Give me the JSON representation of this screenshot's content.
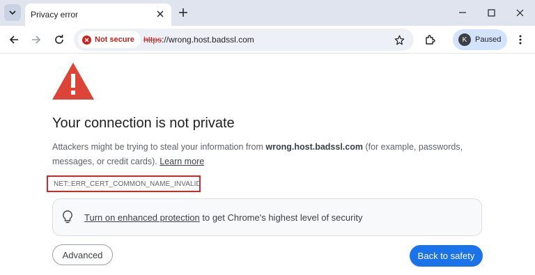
{
  "tab": {
    "title": "Privacy error"
  },
  "omnibox": {
    "security_label": "Not secure",
    "url_scheme": "https",
    "url_rest": "://wrong.host.badssl.com"
  },
  "profile": {
    "initial": "K",
    "status": "Paused"
  },
  "page": {
    "heading": "Your connection is not private",
    "desc_before": "Attackers might be trying to steal your information from ",
    "desc_host": "wrong.host.badssl.com",
    "desc_after": " (for example, passwords, messages, or credit cards). ",
    "learn_more": "Learn more",
    "error_code": "NET::ERR_CERT_COMMON_NAME_INVALID",
    "promo_link": "Turn on enhanced protection",
    "promo_rest": " to get Chrome's highest level of security",
    "advanced_label": "Advanced",
    "back_label": "Back to safety"
  },
  "colors": {
    "accent": "#1a73e8",
    "warning": "#db4437",
    "danger": "#b3261e"
  },
  "icons": [
    "tab-search-icon",
    "close-icon",
    "plus-icon",
    "minimize-icon",
    "maximize-icon",
    "close-window-icon",
    "back-icon",
    "forward-icon",
    "reload-icon",
    "warning-circle-icon",
    "star-icon",
    "extensions-icon",
    "kebab-menu-icon",
    "warning-triangle-icon",
    "lightbulb-icon"
  ]
}
